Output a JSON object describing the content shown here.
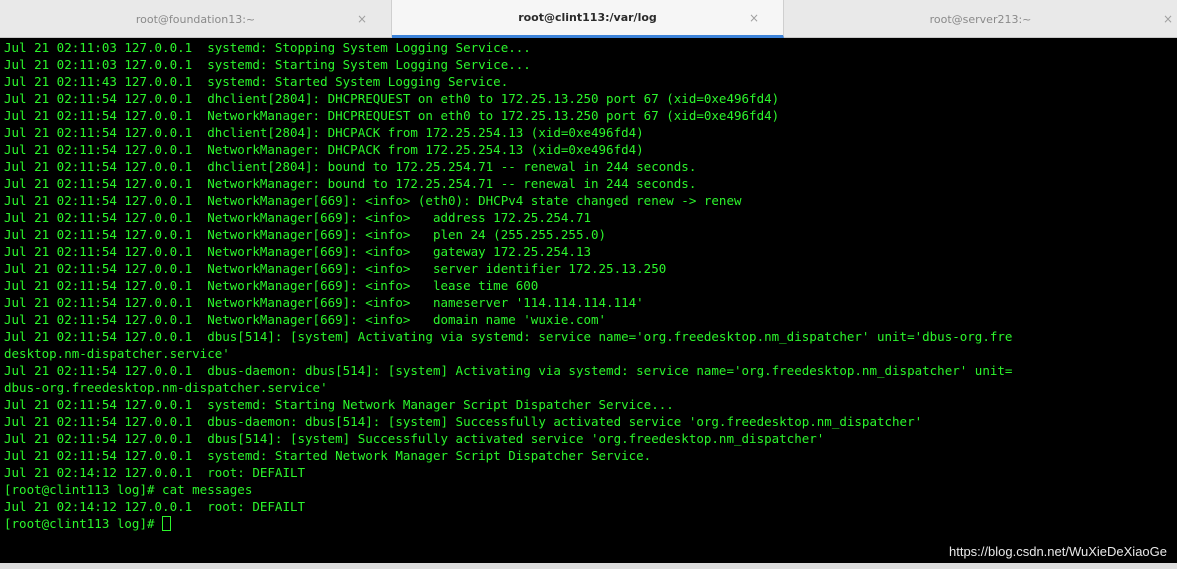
{
  "tabs": [
    {
      "title": "root@foundation13:~",
      "close": "×",
      "active": false
    },
    {
      "title": "root@clint113:/var/log",
      "close": "×",
      "active": true
    },
    {
      "title": "root@server213:~",
      "close": "×",
      "active": false
    }
  ],
  "terminal": {
    "lines": [
      "Jul 21 02:11:03 127.0.0.1  systemd: Stopping System Logging Service...",
      "Jul 21 02:11:03 127.0.0.1  systemd: Starting System Logging Service...",
      "Jul 21 02:11:43 127.0.0.1  systemd: Started System Logging Service.",
      "Jul 21 02:11:54 127.0.0.1  dhclient[2804]: DHCPREQUEST on eth0 to 172.25.13.250 port 67 (xid=0xe496fd4)",
      "Jul 21 02:11:54 127.0.0.1  NetworkManager: DHCPREQUEST on eth0 to 172.25.13.250 port 67 (xid=0xe496fd4)",
      "Jul 21 02:11:54 127.0.0.1  dhclient[2804]: DHCPACK from 172.25.254.13 (xid=0xe496fd4)",
      "Jul 21 02:11:54 127.0.0.1  NetworkManager: DHCPACK from 172.25.254.13 (xid=0xe496fd4)",
      "Jul 21 02:11:54 127.0.0.1  dhclient[2804]: bound to 172.25.254.71 -- renewal in 244 seconds.",
      "Jul 21 02:11:54 127.0.0.1  NetworkManager: bound to 172.25.254.71 -- renewal in 244 seconds.",
      "Jul 21 02:11:54 127.0.0.1  NetworkManager[669]: <info> (eth0): DHCPv4 state changed renew -> renew",
      "Jul 21 02:11:54 127.0.0.1  NetworkManager[669]: <info>   address 172.25.254.71",
      "Jul 21 02:11:54 127.0.0.1  NetworkManager[669]: <info>   plen 24 (255.255.255.0)",
      "Jul 21 02:11:54 127.0.0.1  NetworkManager[669]: <info>   gateway 172.25.254.13",
      "Jul 21 02:11:54 127.0.0.1  NetworkManager[669]: <info>   server identifier 172.25.13.250",
      "Jul 21 02:11:54 127.0.0.1  NetworkManager[669]: <info>   lease time 600",
      "Jul 21 02:11:54 127.0.0.1  NetworkManager[669]: <info>   nameserver '114.114.114.114'",
      "Jul 21 02:11:54 127.0.0.1  NetworkManager[669]: <info>   domain name 'wuxie.com'",
      "Jul 21 02:11:54 127.0.0.1  dbus[514]: [system] Activating via systemd: service name='org.freedesktop.nm_dispatcher' unit='dbus-org.fre",
      "desktop.nm-dispatcher.service'",
      "Jul 21 02:11:54 127.0.0.1  dbus-daemon: dbus[514]: [system] Activating via systemd: service name='org.freedesktop.nm_dispatcher' unit=",
      "dbus-org.freedesktop.nm-dispatcher.service'",
      "Jul 21 02:11:54 127.0.0.1  systemd: Starting Network Manager Script Dispatcher Service...",
      "Jul 21 02:11:54 127.0.0.1  dbus-daemon: dbus[514]: [system] Successfully activated service 'org.freedesktop.nm_dispatcher'",
      "Jul 21 02:11:54 127.0.0.1  dbus[514]: [system] Successfully activated service 'org.freedesktop.nm_dispatcher'",
      "Jul 21 02:11:54 127.0.0.1  systemd: Started Network Manager Script Dispatcher Service.",
      "Jul 21 02:14:12 127.0.0.1  root: DEFAILT",
      "[root@clint113 log]# cat messages",
      "Jul 21 02:14:12 127.0.0.1  root: DEFAILT"
    ],
    "prompt": "[root@clint113 log]# "
  },
  "watermark": "https://blog.csdn.net/WuXieDeXiaoGe",
  "colors": {
    "terminal_bg": "#000000",
    "terminal_text": "#2cf52c",
    "tab_active_underline": "#3d83d9"
  }
}
